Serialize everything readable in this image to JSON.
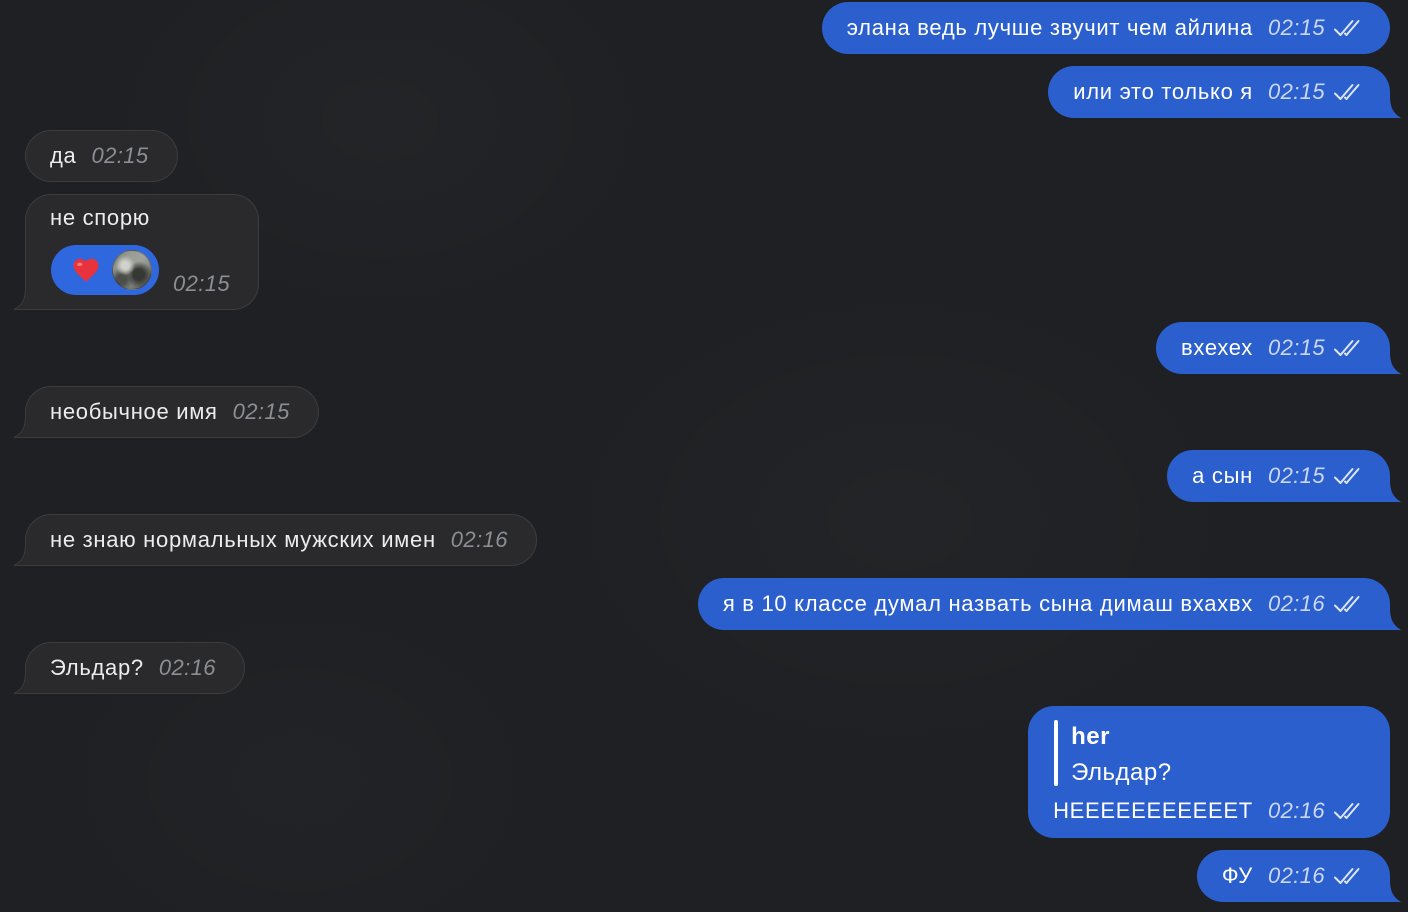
{
  "colors": {
    "background": "#1e2023",
    "outgoing_bubble": "#2b5fcd",
    "incoming_bubble": "#2a2a2c",
    "incoming_border": "#3b3c3f",
    "reaction_pill": "#2f68de",
    "heart": "#e8323c"
  },
  "chat": {
    "messages": [
      {
        "outgoing": true,
        "text": "элана ведь лучше звучит чем айлина",
        "time": "02:15",
        "status_icon": "double-check-icon"
      },
      {
        "outgoing": true,
        "text": "или это только я",
        "time": "02:15",
        "status_icon": "double-check-icon"
      },
      {
        "outgoing": false,
        "text": "да",
        "time": "02:15"
      },
      {
        "outgoing": false,
        "text": "не спорю",
        "time": "02:15",
        "reaction": {
          "icon": "red-heart-icon"
        }
      },
      {
        "outgoing": true,
        "text": "вхехех",
        "time": "02:15",
        "status_icon": "double-check-icon"
      },
      {
        "outgoing": false,
        "text": "необычное имя",
        "time": "02:15"
      },
      {
        "outgoing": true,
        "text": "а сын",
        "time": "02:15",
        "status_icon": "double-check-icon"
      },
      {
        "outgoing": false,
        "text": "не знаю нормальных мужских имен",
        "time": "02:16"
      },
      {
        "outgoing": true,
        "text": "я в 10 классе думал назвать сына димаш вхахвх",
        "time": "02:16",
        "status_icon": "double-check-icon"
      },
      {
        "outgoing": false,
        "text": "Эльдар?",
        "time": "02:16"
      },
      {
        "outgoing": true,
        "reply": {
          "author": "her",
          "text": "Эльдар?"
        },
        "text": "НЕЕЕЕЕЕЕЕЕЕЕТ",
        "time": "02:16",
        "status_icon": "double-check-icon"
      },
      {
        "outgoing": true,
        "text": "ФУ",
        "time": "02:16",
        "status_icon": "double-check-icon"
      }
    ]
  }
}
